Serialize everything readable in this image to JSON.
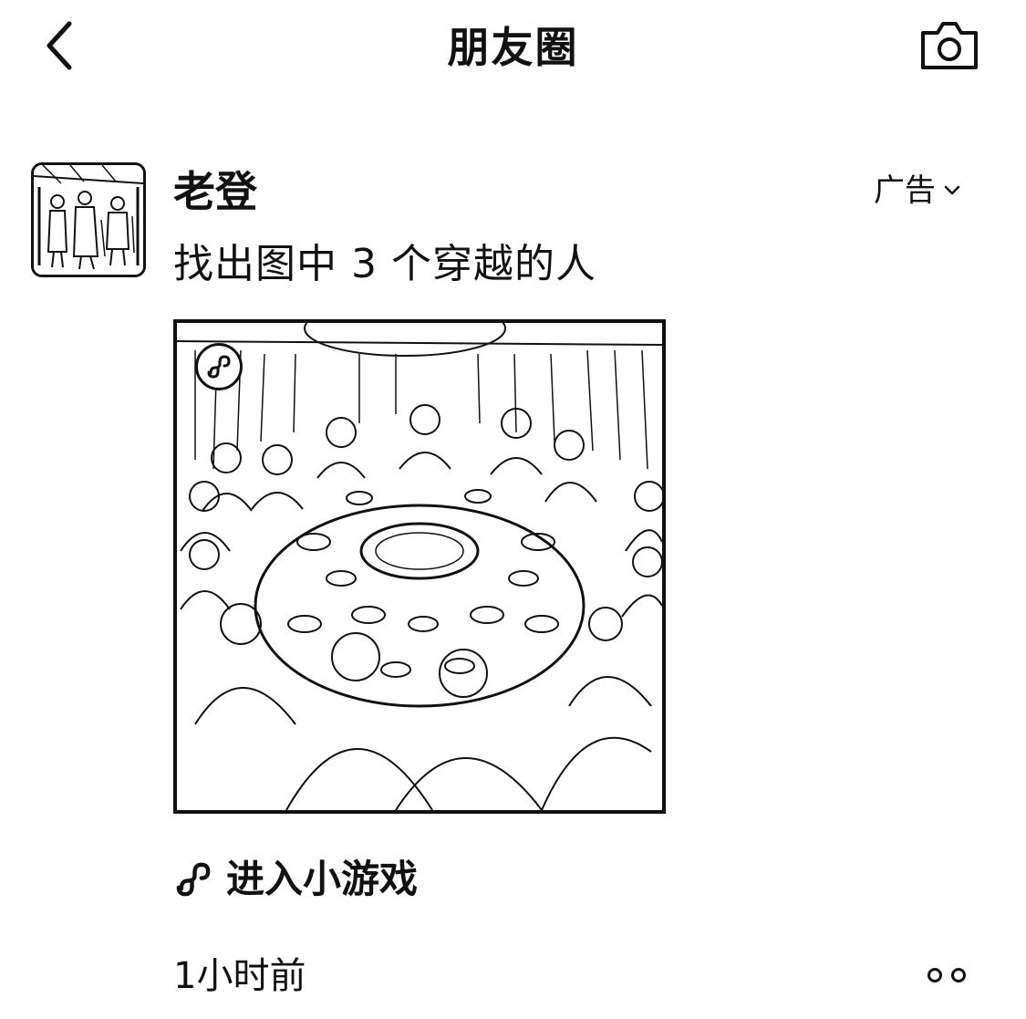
{
  "navbar": {
    "title": "朋友圈",
    "back_icon": "chevron-left-icon",
    "camera_icon": "camera-icon"
  },
  "post": {
    "author": "老登",
    "ad_label": "广告",
    "ad_menu_icon": "chevron-down-icon",
    "text": "找出图中 3 个穿越的人",
    "image_badge_icon": "mini-program-icon",
    "mini_game_icon": "mini-program-icon",
    "mini_game_label": "进入小游戏",
    "timestamp": "1小时前",
    "more_icon": "more-dots-icon"
  },
  "colors": {
    "text": "#111111",
    "background": "#ffffff"
  }
}
